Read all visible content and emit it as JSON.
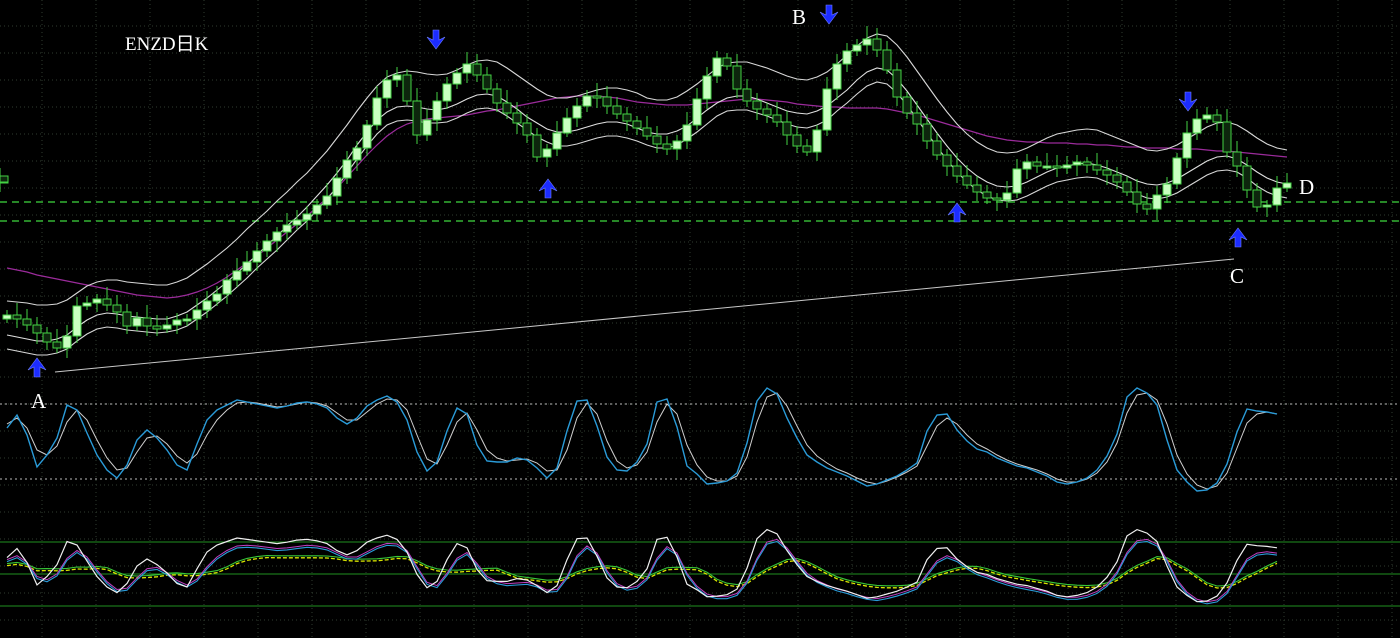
{
  "chart_data": {
    "type": "candlestick",
    "title": "ENZD日K",
    "point_labels": [
      "A",
      "B",
      "C",
      "D"
    ],
    "x": [
      0,
      10,
      20,
      30,
      40,
      50,
      60,
      70,
      80,
      90,
      100,
      110,
      120,
      130,
      140,
      150,
      160,
      170,
      180,
      190,
      200,
      210,
      220,
      230,
      240,
      250,
      260,
      270,
      280,
      290,
      300,
      310,
      320,
      330,
      340,
      350,
      360,
      370,
      380,
      390,
      400,
      410,
      420,
      430,
      440,
      450,
      460,
      470,
      480,
      490,
      500,
      510,
      520,
      530,
      540,
      550,
      560,
      570,
      580,
      590,
      600,
      610,
      620,
      630,
      640,
      650,
      660,
      670,
      680,
      690,
      700,
      710,
      720,
      730,
      740,
      750,
      760,
      770,
      780,
      790,
      800,
      810,
      820,
      830,
      840,
      850,
      860,
      870,
      880,
      890,
      900,
      910,
      920,
      930,
      940,
      950,
      960,
      970,
      980,
      990,
      1000,
      1010,
      1020,
      1030,
      1040,
      1050,
      1060,
      1070,
      1080,
      1090,
      1100,
      1110,
      1120,
      1130,
      1140,
      1150,
      1160,
      1170,
      1180,
      1190,
      1200,
      1210,
      1220,
      1230,
      1240,
      1250,
      1260,
      1270,
      1280
    ],
    "close": [
      315,
      319,
      325,
      333,
      342,
      348,
      336,
      306,
      303,
      299,
      305,
      312,
      326,
      318,
      326,
      329,
      325,
      320,
      319,
      310,
      301,
      294,
      280,
      271,
      262,
      251,
      241,
      232,
      225,
      220,
      214,
      205,
      196,
      178,
      160,
      148,
      125,
      98,
      80,
      75,
      101,
      135,
      120,
      101,
      84,
      73,
      64,
      75,
      89,
      103,
      113,
      123,
      135,
      157,
      149,
      133,
      118,
      106,
      96,
      97,
      106,
      114,
      121,
      128,
      136,
      144,
      149,
      141,
      125,
      99,
      76,
      58,
      66,
      89,
      101,
      109,
      115,
      122,
      135,
      146,
      152,
      130,
      89,
      64,
      51,
      45,
      39,
      50,
      70,
      97,
      113,
      124,
      141,
      155,
      166,
      176,
      185,
      192,
      198,
      200,
      193,
      169,
      162,
      166,
      166,
      168,
      165,
      162,
      165,
      170,
      175,
      182,
      192,
      204,
      209,
      195,
      184,
      158,
      133,
      119,
      115,
      122,
      152,
      166,
      190,
      207,
      205,
      188,
      183,
      176,
      182
    ],
    "ma_fast": [
      335,
      337,
      339,
      341,
      341,
      339,
      335,
      327,
      320,
      315,
      313,
      314,
      316,
      317,
      318,
      319,
      319,
      316,
      312,
      305,
      298,
      290,
      282,
      273,
      264,
      255,
      245,
      236,
      226,
      217,
      207,
      196,
      185,
      173,
      160,
      145,
      132,
      120,
      112,
      107,
      106,
      107,
      109,
      110,
      108,
      104,
      99,
      95,
      94,
      96,
      102,
      109,
      117,
      123,
      129,
      132,
      132,
      130,
      127,
      124,
      122,
      122,
      124,
      128,
      132,
      134,
      134,
      131,
      126,
      118,
      110,
      103,
      98,
      96,
      96,
      99,
      103,
      107,
      111,
      113,
      114,
      111,
      106,
      98,
      90,
      80,
      72,
      68,
      70,
      79,
      91,
      105,
      119,
      133,
      146,
      158,
      168,
      176,
      182,
      186,
      187,
      186,
      182,
      177,
      172,
      168,
      166,
      164,
      163,
      165,
      168,
      172,
      176,
      181,
      184,
      185,
      183,
      179,
      173,
      167,
      161,
      157,
      156,
      159,
      165,
      172,
      178,
      182,
      184,
      184,
      183
    ],
    "band_upper": [
      301,
      302,
      303,
      305,
      305,
      304,
      300,
      293,
      286,
      282,
      280,
      280,
      282,
      283,
      284,
      285,
      285,
      282,
      278,
      271,
      264,
      256,
      248,
      239,
      229,
      220,
      211,
      201,
      192,
      182,
      173,
      162,
      151,
      138,
      125,
      111,
      98,
      86,
      77,
      73,
      71,
      72,
      74,
      75,
      74,
      70,
      65,
      61,
      60,
      62,
      68,
      75,
      82,
      89,
      95,
      98,
      98,
      96,
      93,
      90,
      88,
      88,
      90,
      93,
      98,
      100,
      100,
      97,
      91,
      84,
      76,
      68,
      63,
      62,
      62,
      65,
      68,
      72,
      76,
      79,
      80,
      77,
      72,
      64,
      55,
      46,
      38,
      34,
      36,
      45,
      57,
      71,
      85,
      99,
      112,
      124,
      134,
      142,
      148,
      152,
      153,
      152,
      148,
      143,
      138,
      134,
      132,
      130,
      129,
      130,
      134,
      138,
      142,
      146,
      150,
      151,
      149,
      145,
      139,
      133,
      127,
      123,
      122,
      125,
      131,
      138,
      144,
      148,
      150,
      150,
      149
    ],
    "band_lower": [
      349,
      351,
      353,
      355,
      355,
      353,
      349,
      341,
      334,
      329,
      327,
      328,
      330,
      331,
      332,
      333,
      332,
      330,
      326,
      319,
      312,
      304,
      296,
      287,
      278,
      268,
      259,
      250,
      240,
      230,
      221,
      210,
      199,
      187,
      173,
      159,
      146,
      134,
      125,
      121,
      120,
      121,
      123,
      123,
      122,
      118,
      113,
      109,
      108,
      110,
      116,
      123,
      130,
      137,
      142,
      146,
      146,
      144,
      141,
      138,
      136,
      136,
      138,
      141,
      145,
      148,
      148,
      145,
      139,
      132,
      124,
      116,
      111,
      110,
      110,
      113,
      116,
      120,
      124,
      127,
      128,
      125,
      120,
      111,
      103,
      94,
      86,
      82,
      84,
      93,
      105,
      119,
      133,
      147,
      160,
      172,
      182,
      190,
      196,
      200,
      201,
      200,
      196,
      191,
      186,
      182,
      180,
      178,
      177,
      178,
      182,
      186,
      190,
      194,
      198,
      199,
      197,
      193,
      187,
      181,
      175,
      171,
      170,
      172,
      178,
      186,
      192,
      196,
      198,
      198,
      197
    ],
    "ma_slow": [
      268,
      270,
      272,
      275,
      277,
      279,
      281,
      283,
      285,
      287,
      289,
      291,
      293,
      295,
      296,
      297,
      298,
      297,
      295,
      292,
      288,
      283,
      277,
      270,
      263,
      256,
      248,
      240,
      232,
      224,
      216,
      207,
      198,
      188,
      177,
      166,
      155,
      145,
      136,
      129,
      124,
      121,
      119,
      118,
      117,
      116,
      115,
      113,
      111,
      110,
      108,
      106,
      104,
      102,
      100,
      98,
      97,
      96,
      96,
      96,
      97,
      98,
      100,
      102,
      103,
      104,
      105,
      105,
      105,
      104,
      103,
      102,
      101,
      100,
      99,
      99,
      100,
      101,
      102,
      104,
      105,
      106,
      107,
      107,
      108,
      108,
      108,
      108,
      109,
      111,
      113,
      115,
      118,
      121,
      124,
      127,
      130,
      133,
      136,
      138,
      140,
      141,
      142,
      142,
      143,
      143,
      143,
      144,
      144,
      145,
      145,
      146,
      147,
      147,
      148,
      148,
      148,
      149,
      149,
      149,
      150,
      151,
      151,
      152,
      153,
      154,
      155,
      156,
      157,
      158,
      159
    ],
    "stochastic_k": [
      428,
      415,
      435,
      467,
      455,
      438,
      405,
      410,
      433,
      455,
      470,
      478,
      465,
      440,
      430,
      438,
      450,
      465,
      470,
      444,
      420,
      410,
      405,
      400,
      402,
      404,
      406,
      408,
      406,
      403,
      402,
      404,
      408,
      418,
      424,
      418,
      406,
      400,
      396,
      402,
      420,
      452,
      471,
      462,
      431,
      408,
      414,
      445,
      461,
      462,
      462,
      458,
      460,
      468,
      478,
      468,
      431,
      401,
      400,
      426,
      457,
      470,
      471,
      462,
      444,
      402,
      399,
      427,
      466,
      474,
      484,
      483,
      481,
      473,
      443,
      401,
      388,
      394,
      418,
      438,
      455,
      462,
      468,
      472,
      476,
      481,
      486,
      484,
      480,
      476,
      470,
      463,
      431,
      415,
      414,
      430,
      441,
      449,
      452,
      458,
      462,
      466,
      468,
      472,
      476,
      482,
      484,
      482,
      478,
      470,
      456,
      434,
      397,
      388,
      393,
      405,
      440,
      470,
      482,
      491,
      490,
      483,
      464,
      432,
      409,
      411,
      412,
      414
    ],
    "stochastic_d": [
      424,
      418,
      428,
      450,
      455,
      446,
      422,
      410,
      420,
      440,
      458,
      470,
      468,
      452,
      438,
      436,
      444,
      456,
      463,
      454,
      435,
      420,
      410,
      403,
      402,
      403,
      405,
      407,
      406,
      404,
      402,
      403,
      406,
      413,
      420,
      420,
      412,
      404,
      399,
      400,
      410,
      435,
      459,
      464,
      445,
      422,
      413,
      430,
      450,
      458,
      461,
      460,
      459,
      463,
      471,
      470,
      450,
      418,
      403,
      414,
      441,
      461,
      468,
      465,
      452,
      422,
      404,
      414,
      445,
      465,
      477,
      481,
      481,
      476,
      457,
      422,
      397,
      393,
      406,
      426,
      445,
      456,
      463,
      469,
      473,
      478,
      482,
      484,
      481,
      477,
      472,
      466,
      446,
      426,
      418,
      424,
      435,
      444,
      449,
      455,
      460,
      464,
      467,
      470,
      474,
      479,
      482,
      482,
      479,
      473,
      462,
      443,
      413,
      395,
      393,
      400,
      424,
      455,
      474,
      485,
      489,
      486,
      473,
      448,
      423,
      414,
      412,
      414
    ]
  }
}
